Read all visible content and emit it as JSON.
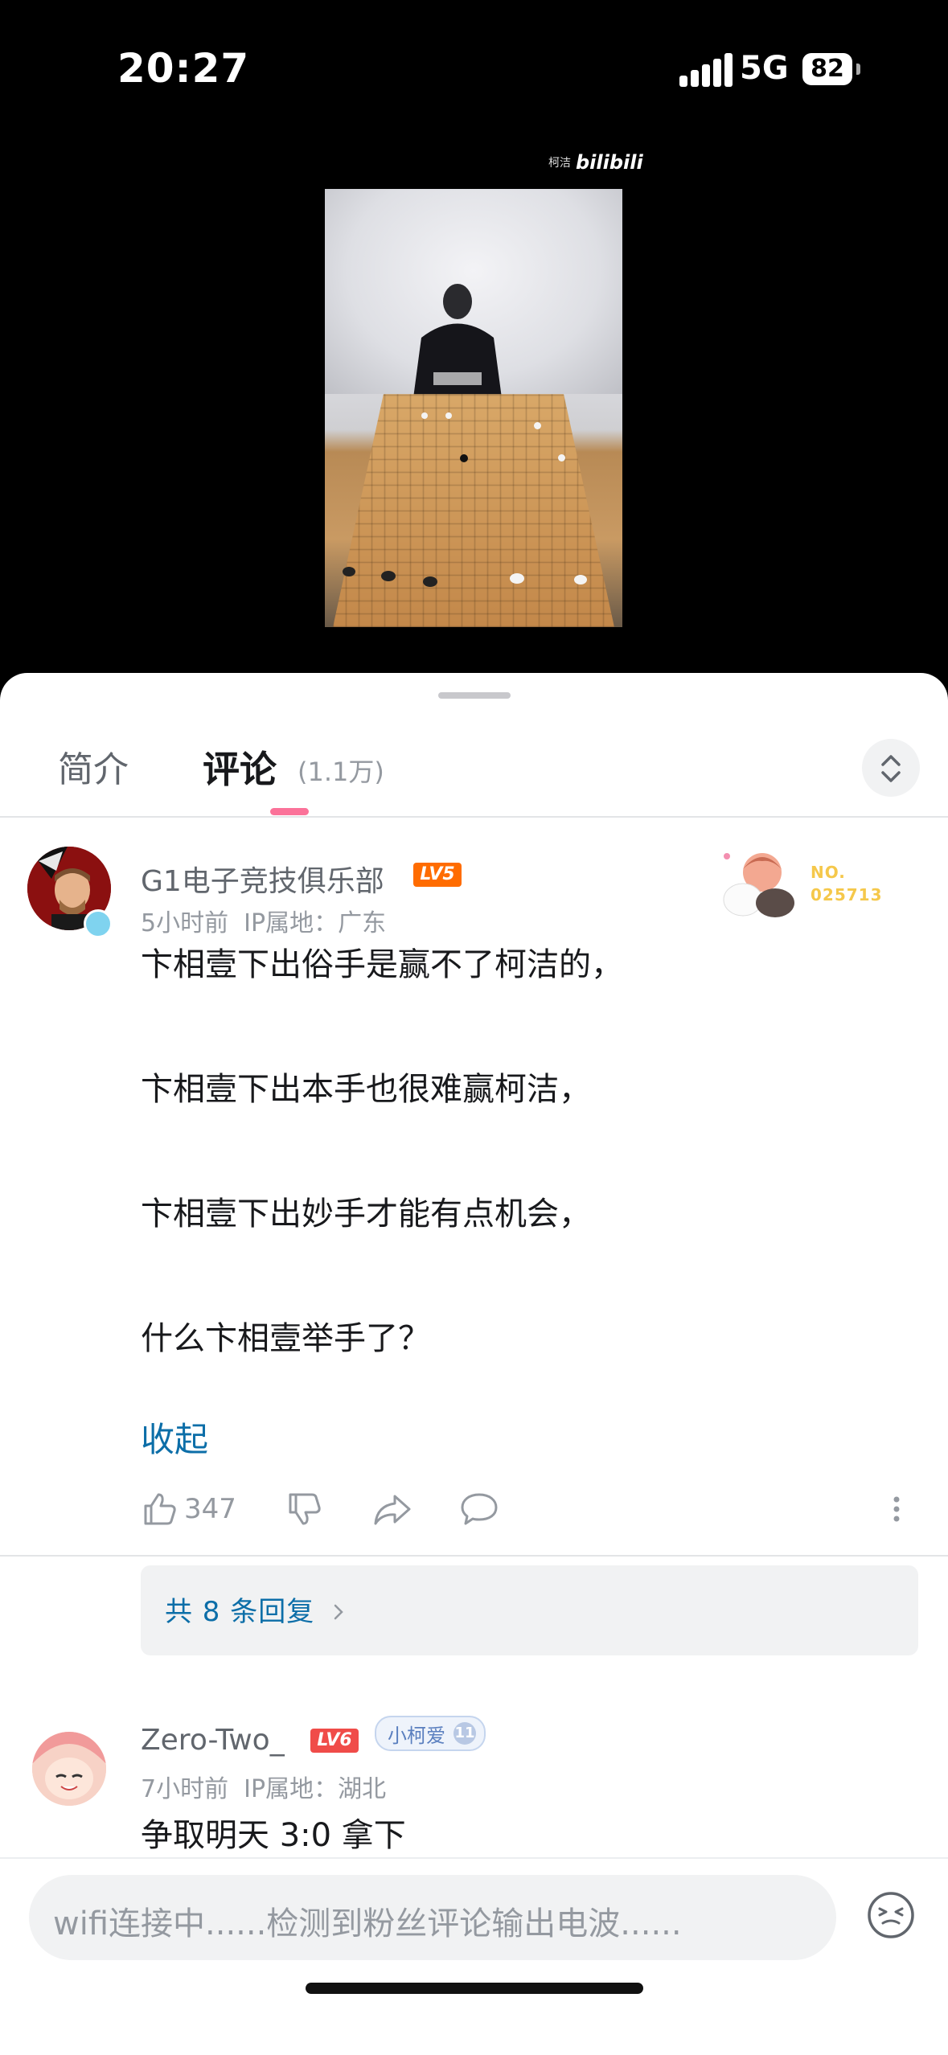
{
  "status": {
    "time": "20:27",
    "network": "5G",
    "battery": "82"
  },
  "video": {
    "watermark_author": "柯洁",
    "watermark_brand": "bilibili"
  },
  "tabs": {
    "intro": "简介",
    "comments": "评论",
    "comment_count": "(1.1万)"
  },
  "comments": [
    {
      "username": "G1电子竞技俱乐部",
      "level": "LV5",
      "level_color": "#ff6c00",
      "time": "5小时前",
      "ip": "IP属地：广东",
      "fan_badge_no": "NO.",
      "fan_badge_id": "025713",
      "lines": [
        "卞相壹下出俗手是赢不了柯洁的，",
        "卞相壹下出本手也很难赢柯洁，",
        "卞相壹下出妙手才能有点机会，",
        "什么卞相壹举手了？"
      ],
      "collapse": "收起",
      "likes": "347",
      "replies": "共 8 条回复"
    },
    {
      "username": "Zero-Two_",
      "level": "LV6",
      "level_color": "#f04c49",
      "medal_name": "小柯爱",
      "medal_level": "11",
      "time": "7小时前",
      "ip": "IP属地：湖北",
      "body": "争取明天 3:0 拿下"
    }
  ],
  "input": {
    "placeholder": "wifi连接中......检测到粉丝评论输出电波......"
  },
  "colors": {
    "accent": "#fb7299",
    "link": "#0c6ea8"
  }
}
